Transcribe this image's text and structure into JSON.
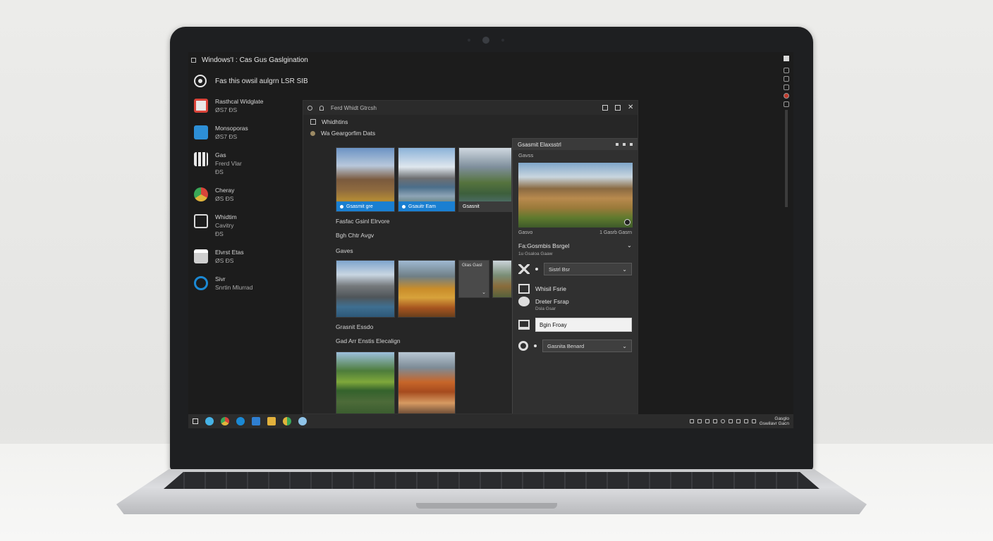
{
  "window_title": "Windows'I : Cas Gus Gaslgination",
  "search_text": "Fas this owsil aulgrn LSR SIB",
  "sidebar": {
    "items": [
      {
        "title": "Rasthcal Widglate",
        "sub": "ØS7 ĐS",
        "icon": "photo-app-icon",
        "color": "#d9443a"
      },
      {
        "title": "Monsoporas",
        "sub": "ØS7 ĐS",
        "icon": "cloud-app-icon",
        "color": "#2d8fd6"
      },
      {
        "title": "Gas",
        "sub": "Frerd Vlar",
        "extra": "ĐS",
        "icon": "qr-app-icon",
        "color": "#e8e8e8"
      },
      {
        "title": "Cheray",
        "sub": "ØS ĐS",
        "icon": "chrome-app-icon",
        "color": "#e0b43b"
      },
      {
        "title": "Whidtim",
        "sub": "Cavitry",
        "extra": "ĐS",
        "icon": "film-app-icon",
        "color": "#dadada"
      },
      {
        "title": "Elvrst Etas",
        "sub": "ØS ĐS",
        "icon": "store-app-icon",
        "color": "#cfcfcf"
      },
      {
        "title": "Sivr",
        "sub": "Snrtin Mlurrad",
        "extra": "bulb",
        "icon": "edge-app-icon",
        "color": "#1b89d4"
      }
    ]
  },
  "photo_window": {
    "bar_title": "Ferd Whidt Gtrcsh",
    "row1": "Whidhtins",
    "row2": "Wa Geargorfim Dats",
    "thumb_captions": [
      "Gsasmit gre",
      "Gsauitr Eam",
      "Gsasnit"
    ],
    "section1": "Fasfac Gsinl Elrvore",
    "section1_sub": "Bgh Chtr Avgv",
    "section2": "Gaves",
    "group_tile": "Glas Gasl",
    "section3": "Grasnit Essdo",
    "section4": "Gad Arr Enstis Elecalign"
  },
  "detail_panel": {
    "header": "Gsasmit Elaxsstrl",
    "preview_label": "Gavss",
    "caption_left": "Gasvo",
    "caption_right": "1 Gasrb Gasrn",
    "title": "Fa:Gosmbis Bsrgel",
    "subtitle": "1u Gsaloa Gaaw",
    "rows": [
      {
        "icon": "sparkle-tool-icon",
        "label": "Sistrl Bsr",
        "type": "select"
      },
      {
        "icon": "image-tool-icon",
        "label": "Whisil Fsrie",
        "type": "text"
      },
      {
        "icon": "palette-tool-icon",
        "label": "Dreter Fsrap",
        "sub": "Dsla Gsar",
        "type": "text"
      },
      {
        "icon": "screen-tool-icon",
        "label": "Bgin Froay",
        "type": "input"
      },
      {
        "icon": "circle-tool-icon",
        "label": "Gasnita Benard",
        "type": "select"
      }
    ]
  },
  "taskbar": {
    "clock_line1": "Gasglo",
    "clock_line2": "Gswilavr Gacn"
  }
}
